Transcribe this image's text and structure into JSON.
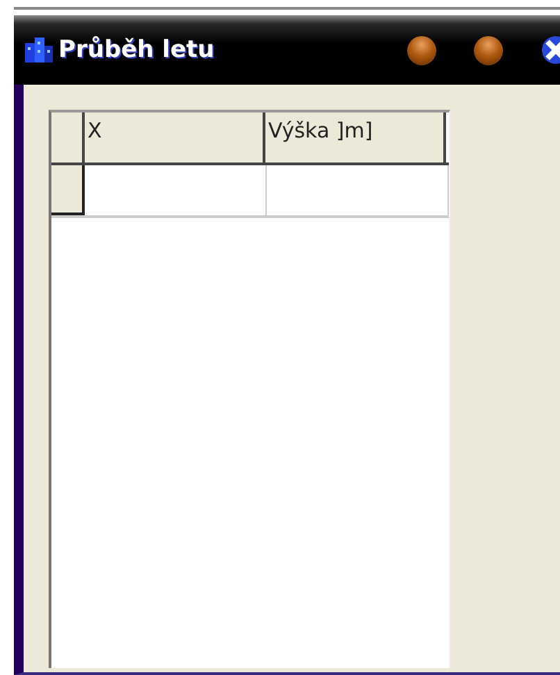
{
  "window": {
    "title": "Průběh letu"
  },
  "table": {
    "columns": [
      "X",
      "Výška ]m]"
    ],
    "rows": [
      {
        "selected": true,
        "cells": [
          "",
          ""
        ]
      }
    ]
  }
}
